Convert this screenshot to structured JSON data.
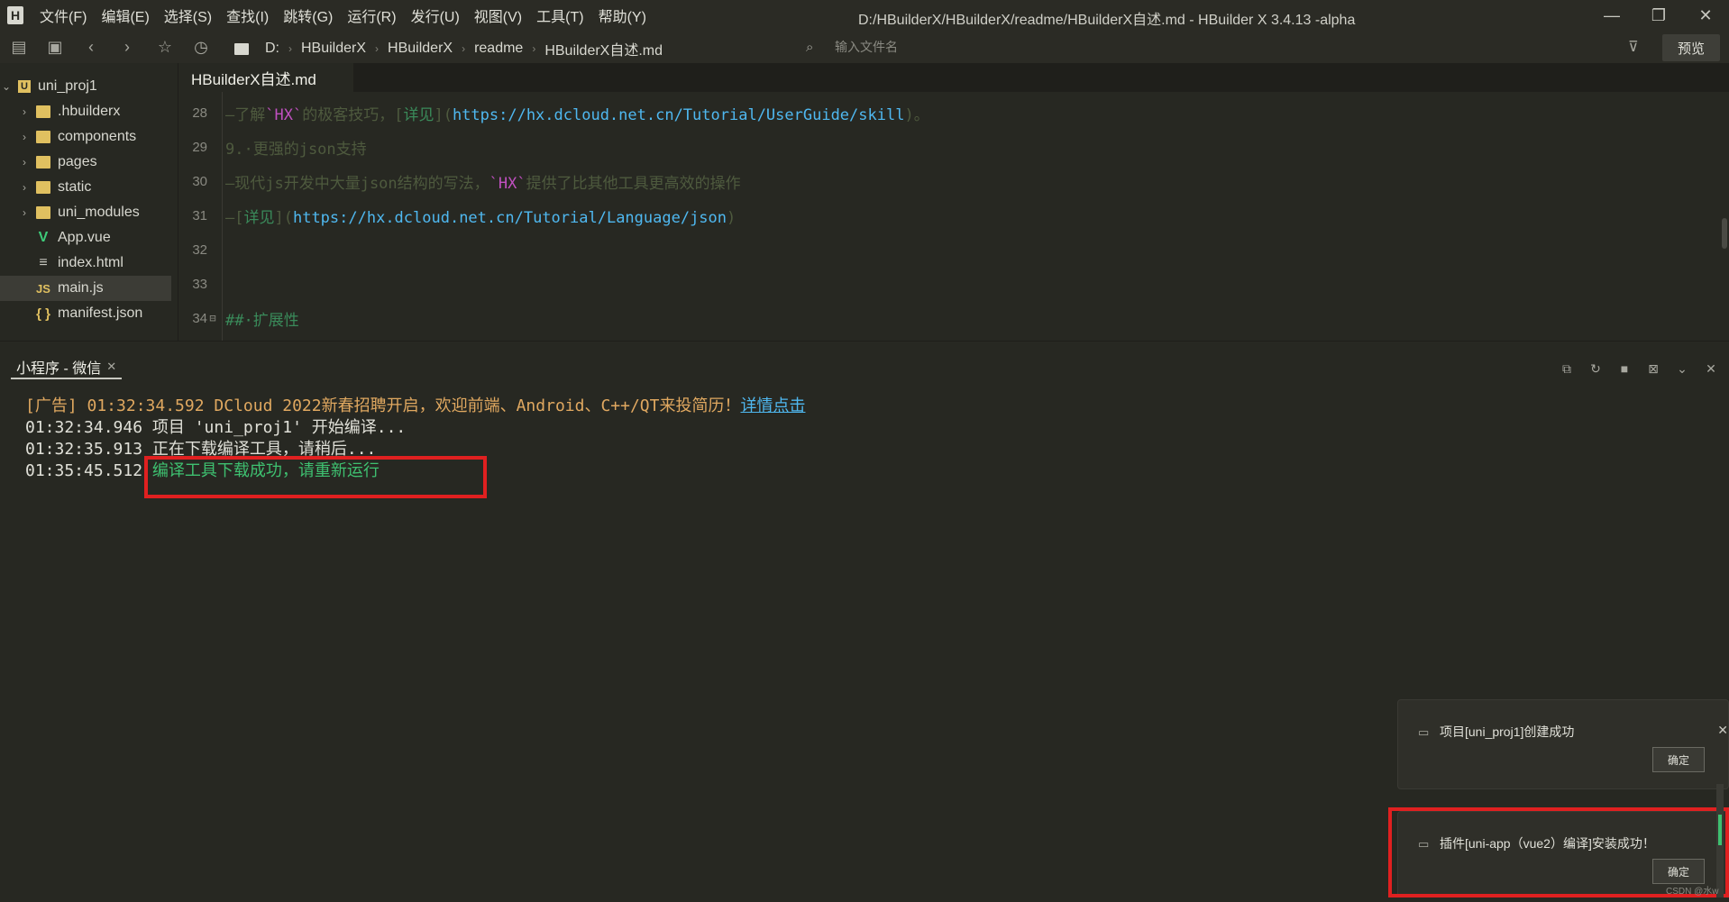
{
  "titlebar": {
    "menu": [
      "文件(F)",
      "编辑(E)",
      "选择(S)",
      "查找(I)",
      "跳转(G)",
      "运行(R)",
      "发行(U)",
      "视图(V)",
      "工具(T)",
      "帮助(Y)"
    ],
    "window_title": "D:/HBuilderX/HBuilderX/readme/HBuilderX自述.md - HBuilder X 3.4.13 -alpha"
  },
  "toolbar": {
    "breadcrumbs": [
      "D:",
      "HBuilderX",
      "HBuilderX",
      "readme",
      "HBuilderX自述.md"
    ],
    "search_placeholder": "输入文件名",
    "preview_label": "预览"
  },
  "sidebar": {
    "project": "uni_proj1",
    "items": [
      {
        "label": ".hbuilderx",
        "type": "folder"
      },
      {
        "label": "components",
        "type": "folder"
      },
      {
        "label": "pages",
        "type": "folder"
      },
      {
        "label": "static",
        "type": "folder"
      },
      {
        "label": "uni_modules",
        "type": "folder"
      },
      {
        "label": "App.vue",
        "type": "vue"
      },
      {
        "label": "index.html",
        "type": "html"
      },
      {
        "label": "main.js",
        "type": "js"
      },
      {
        "label": "manifest.json",
        "type": "json"
      }
    ]
  },
  "editor": {
    "tab": "HBuilderX自述.md",
    "lines": [
      {
        "n": "28",
        "a": "—了解",
        "b": "`HX`",
        "c": "的极客技巧，[",
        "d": "详见",
        "e": "](",
        "f": "https://hx.dcloud.net.cn/Tutorial/UserGuide/skill",
        "g": ")。"
      },
      {
        "n": "29",
        "a": "9.·更强的json支持"
      },
      {
        "n": "30",
        "a": "—现代js开发中大量json结构的写法，",
        "b": "`HX`",
        "c": "提供了比其他工具更高效的操作"
      },
      {
        "n": "31",
        "a": "—[",
        "d": "详见",
        "e": "](",
        "f": "https://hx.dcloud.net.cn/Tutorial/Language/json",
        "g": ")"
      },
      {
        "n": "32"
      },
      {
        "n": "33"
      },
      {
        "n": "34",
        "a": "##·扩展性"
      }
    ]
  },
  "panel": {
    "tab": "小程序 - 微信",
    "console": {
      "line1_text": "[广告] 01:32:34.592 DCloud 2022新春招聘开启，欢迎前端、Android、C++/QT来投简历！",
      "line1_link": "详情点击",
      "line2": "01:32:34.946 项目 'uni_proj1' 开始编译...",
      "line3": "01:32:35.913 正在下载编译工具，请稍后...",
      "line4_ts": "01:35:45.512",
      "line4_msg": "编译工具下载成功，请重新运行"
    }
  },
  "notifications": [
    {
      "text": "项目[uni_proj1]创建成功",
      "button": "确定"
    },
    {
      "text": "插件[uni-app（vue2）编译]安装成功！",
      "button": "确定"
    }
  ],
  "watermark": "CSDN @水w",
  "colors": {
    "background": "#272822",
    "highlight": "#e02020",
    "success": "#3ec070",
    "link": "#4fb8f0"
  }
}
